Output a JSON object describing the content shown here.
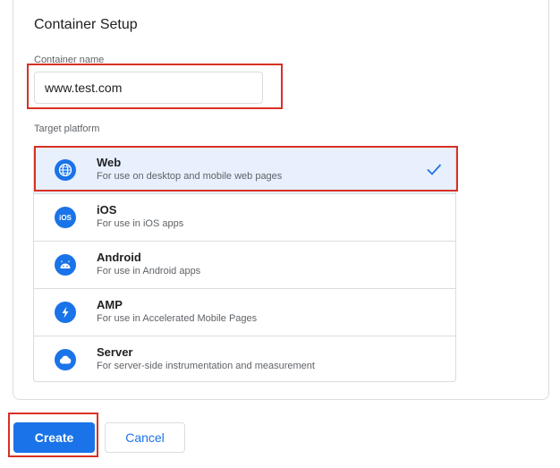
{
  "section_title": "Container Setup",
  "container_name": {
    "label": "Container name",
    "value": "www.test.com"
  },
  "target_platform": {
    "label": "Target platform",
    "selected": "Web",
    "items": [
      {
        "name": "Web",
        "desc": "For use on desktop and mobile web pages",
        "icon": "globe-icon"
      },
      {
        "name": "iOS",
        "desc": "For use in iOS apps",
        "icon": "ios-icon"
      },
      {
        "name": "Android",
        "desc": "For use in Android apps",
        "icon": "android-icon"
      },
      {
        "name": "AMP",
        "desc": "For use in Accelerated Mobile Pages",
        "icon": "amp-bolt-icon"
      },
      {
        "name": "Server",
        "desc": "For server-side instrumentation and measurement",
        "icon": "cloud-icon"
      }
    ]
  },
  "buttons": {
    "create": "Create",
    "cancel": "Cancel"
  },
  "colors": {
    "accent": "#1a73e8",
    "highlight": "#d93025",
    "selected_bg": "#e8f0fe"
  },
  "icon_text": {
    "ios": "iOS"
  }
}
